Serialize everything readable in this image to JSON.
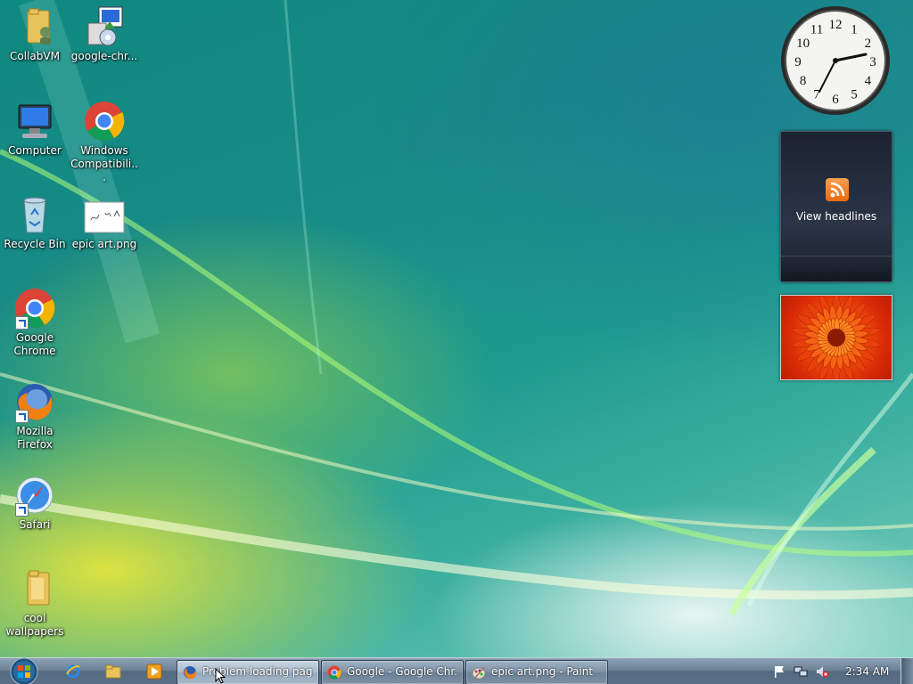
{
  "desktop_icons": [
    {
      "label": "CollabVM",
      "icon": "folder-user-icon"
    },
    {
      "label": "google-chr...",
      "icon": "installer-icon"
    },
    {
      "label": "Computer",
      "icon": "computer-icon"
    },
    {
      "label": "Windows Compatibili...",
      "icon": "chrome-icon"
    },
    {
      "label": "Recycle Bin",
      "icon": "recycle-bin-icon"
    },
    {
      "label": "epic art.png",
      "icon": "image-file-icon"
    },
    {
      "label": "Google Chrome",
      "icon": "chrome-icon"
    },
    {
      "label": "Mozilla Firefox",
      "icon": "firefox-icon"
    },
    {
      "label": "Safari",
      "icon": "safari-icon"
    },
    {
      "label": "cool wallpapers",
      "icon": "folder-icon"
    }
  ],
  "gadgets": {
    "clock": {
      "time": "2:34",
      "numerals": [
        "12",
        "1",
        "2",
        "3",
        "4",
        "5",
        "6",
        "7",
        "8",
        "9",
        "10",
        "11"
      ]
    },
    "feed": {
      "label": "View headlines"
    },
    "slideshow": {
      "subject": "orange flower"
    }
  },
  "taskbar": {
    "start_icon": "windows-orb-icon",
    "quick_launch": [
      "internet-explorer-icon",
      "explorer-folder-icon",
      "media-player-icon"
    ],
    "tasks": [
      {
        "label": "Problem loading pag...",
        "icon": "firefox-icon",
        "active": true
      },
      {
        "label": "Google - Google Chr...",
        "icon": "chrome-icon",
        "active": false
      },
      {
        "label": "epic art.png - Paint",
        "icon": "paint-icon",
        "active": false
      }
    ],
    "tray": {
      "icons": [
        "flag-icon",
        "network-icon",
        "volume-muted-icon"
      ],
      "time": "2:34 AM"
    }
  },
  "colors": {
    "taskbar": "#6b8196",
    "accent": "#1b5fbf"
  }
}
